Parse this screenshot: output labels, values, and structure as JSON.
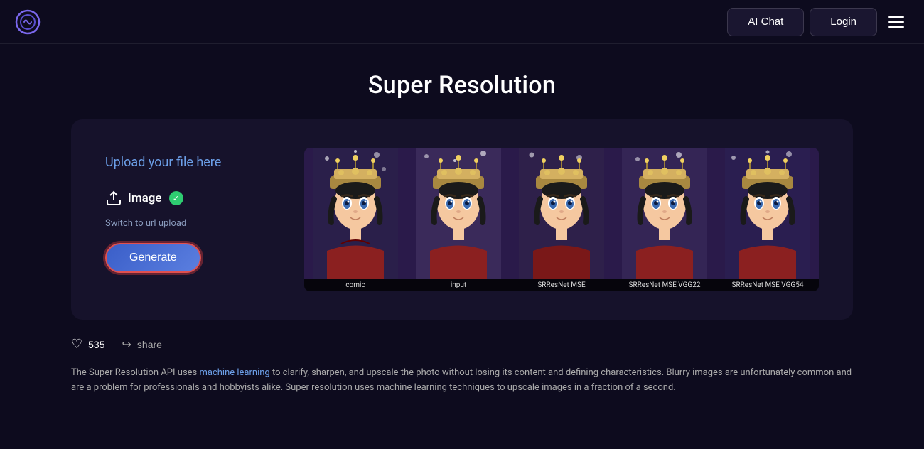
{
  "app": {
    "logo_alt": "App Logo"
  },
  "header": {
    "ai_chat_label": "AI Chat",
    "login_label": "Login",
    "menu_label": "Menu"
  },
  "page": {
    "title": "Super Resolution"
  },
  "upload_panel": {
    "upload_label": "Upload your file here",
    "image_label": "Image",
    "url_switch_label": "Switch to url upload",
    "generate_label": "Generate"
  },
  "image_labels": [
    "comic",
    "input",
    "SRResNet MSE",
    "SRResNet MSE VGG22",
    "SRResNet MSE VGG54"
  ],
  "social": {
    "like_count": "535",
    "share_label": "share"
  },
  "description": {
    "text_before_link": "The Super Resolution API uses ",
    "link_text": "machine learning",
    "text_after_link": " to clarify, sharpen, and upscale the photo without losing its content and defining characteristics. Blurry images are unfortunately common and are a problem for professionals and hobbyists alike. Super resolution uses machine learning techniques to upscale images in a fraction of a second."
  },
  "colors": {
    "background": "#0d0b1e",
    "card_bg": "#16122b",
    "accent_blue": "#6c9fe8",
    "generate_border": "#e05050",
    "check_green": "#2ecc71"
  }
}
